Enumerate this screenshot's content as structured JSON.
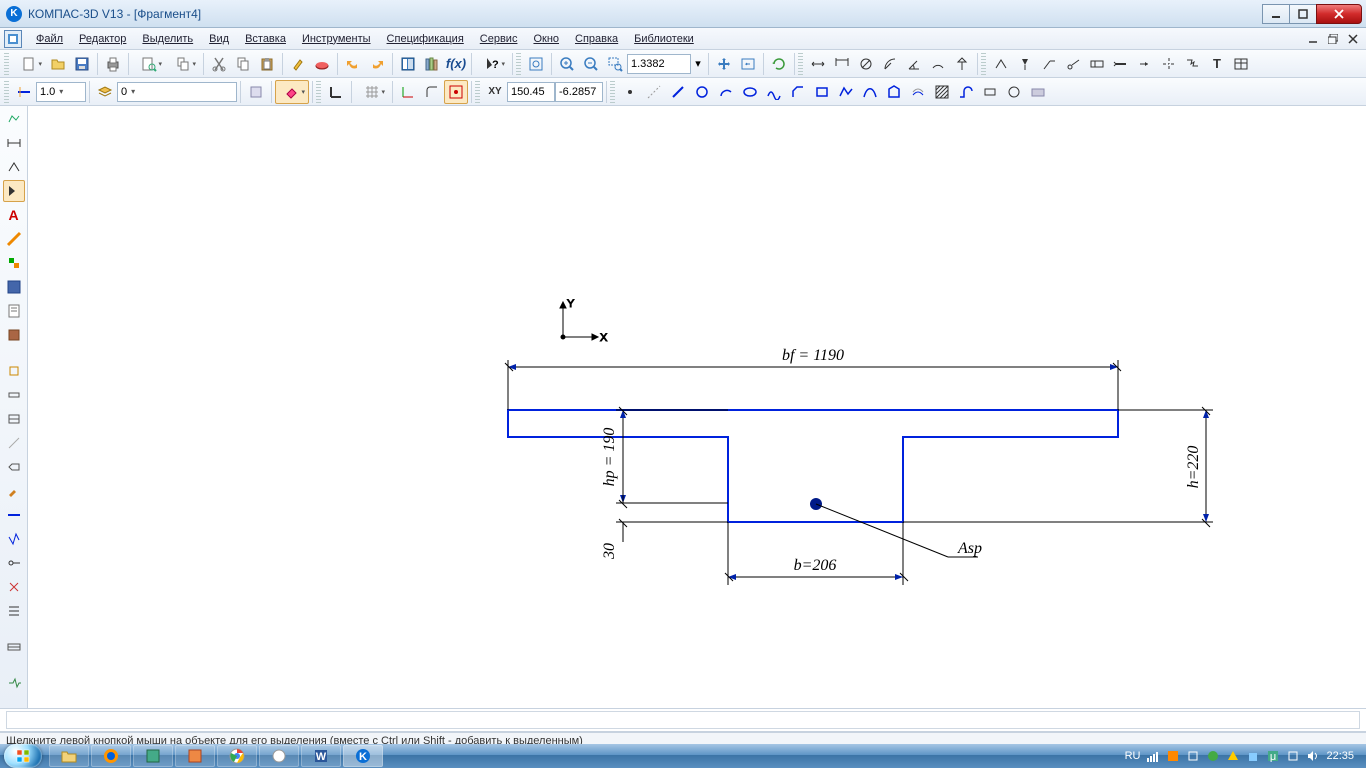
{
  "title": "КОМПАС-3D V13 - [Фрагмент4]",
  "menus": [
    "Файл",
    "Редактор",
    "Выделить",
    "Вид",
    "Вставка",
    "Инструменты",
    "Спецификация",
    "Сервис",
    "Окно",
    "Справка",
    "Библиотеки"
  ],
  "toolbar2": {
    "scale": "1.0",
    "layer": "0"
  },
  "zoom": "1.3382",
  "coords": {
    "x": "150.45",
    "y": "-6.2857"
  },
  "drawing": {
    "dim_bf": "bf = 1190",
    "dim_h": "h=220",
    "dim_hp": "hp = 190",
    "dim_b": "b=206",
    "dim_30": "30",
    "label_asp": "Asp"
  },
  "status": "Щелкните левой кнопкой мыши на объекте для его выделения (вместе с Ctrl или Shift - добавить к выделенным)",
  "taskbar": {
    "lang": "RU",
    "time": "22:35"
  }
}
